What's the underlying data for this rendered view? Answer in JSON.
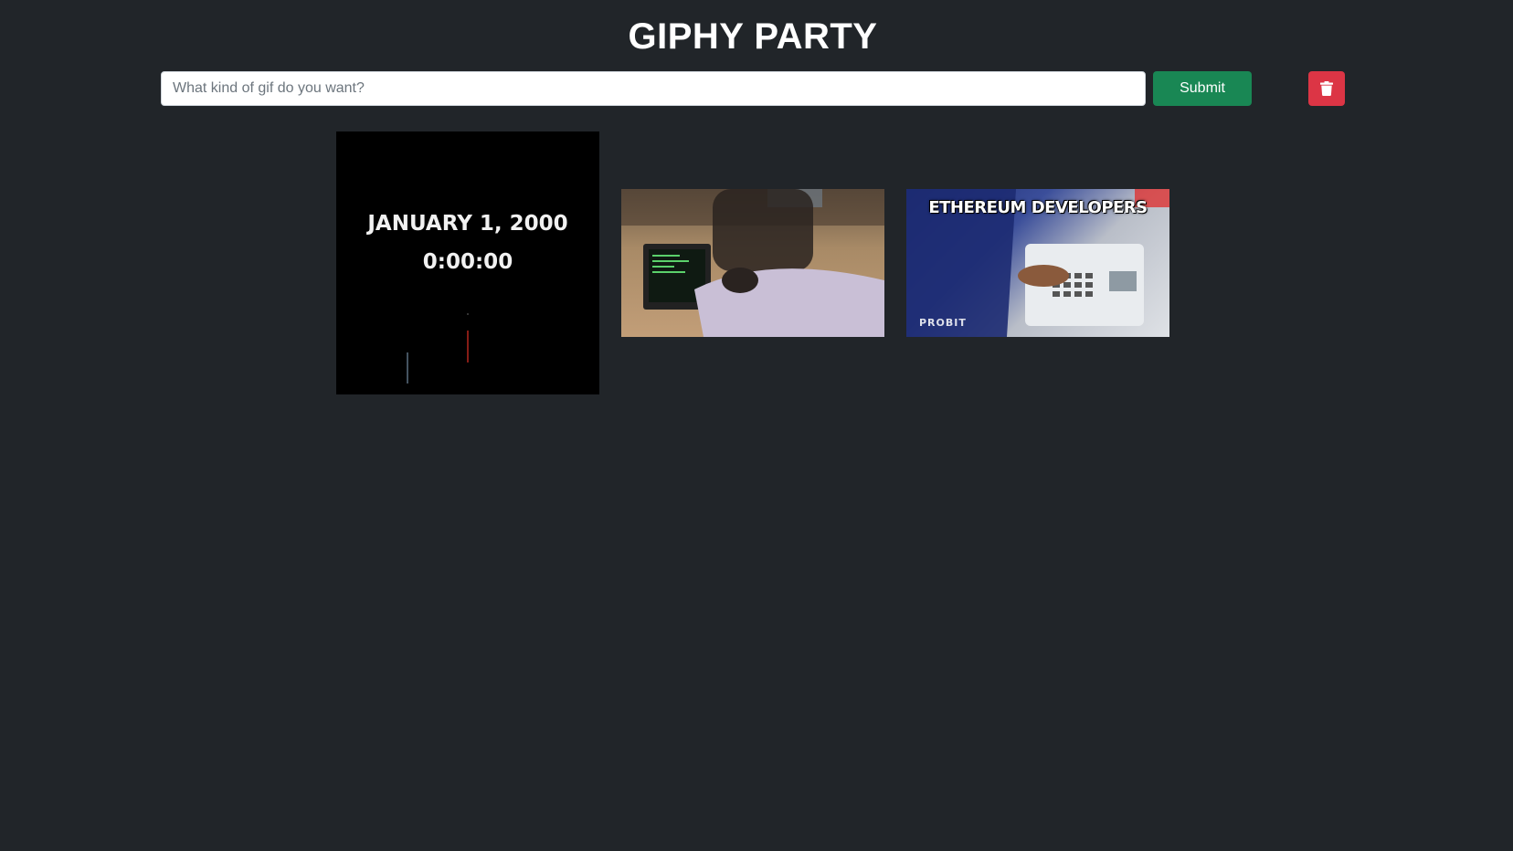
{
  "app": {
    "title": "GIPHY PARTY"
  },
  "search": {
    "placeholder": "What kind of gif do you want?",
    "value": ""
  },
  "buttons": {
    "submit_label": "Submit",
    "delete_icon": "trash-icon"
  },
  "colors": {
    "background": "#212529",
    "submit": "#198754",
    "delete": "#dc3545"
  },
  "gifs": [
    {
      "description_icon": "gif-image",
      "text_lines": [
        "JANUARY 1, 2000",
        "0:00:00"
      ]
    },
    {
      "description_icon": "gif-image",
      "text_lines": []
    },
    {
      "description_icon": "gif-image",
      "caption": "ETHEREUM DEVELOPERS",
      "watermark": "PROBIT"
    }
  ]
}
